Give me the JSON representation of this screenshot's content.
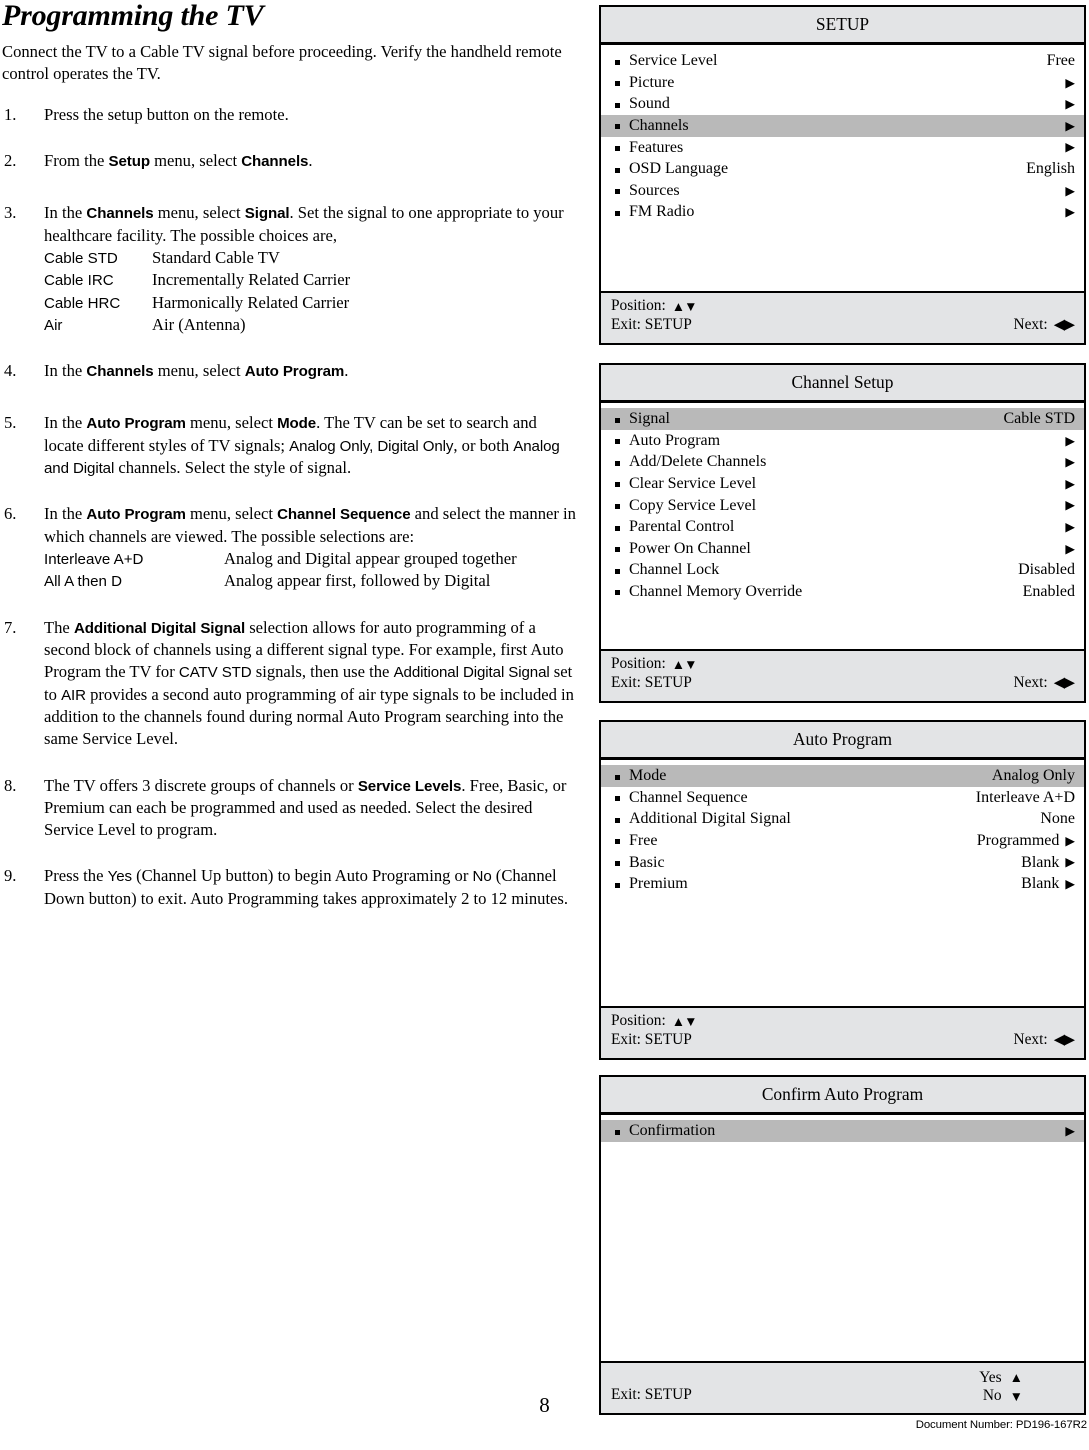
{
  "page": {
    "title": "Programming the TV",
    "intro": "Connect the TV to a Cable TV signal before proceeding.  Verify the handheld remote control operates the TV.",
    "page_number": "8",
    "document_number": "Document Number: PD196-167R2"
  },
  "steps": [
    {
      "num": "1.",
      "parts": [
        {
          "t": "Press the setup button on the remote.",
          "s": "serif"
        }
      ]
    },
    {
      "num": "2.",
      "parts": [
        {
          "t": "From the ",
          "s": "serif"
        },
        {
          "t": "Setup",
          "s": "sans-bold"
        },
        {
          "t": " menu, select ",
          "s": "serif"
        },
        {
          "t": "Channels",
          "s": "sans-bold"
        },
        {
          "t": ".",
          "s": "serif"
        }
      ]
    },
    {
      "num": "3.",
      "parts": [
        {
          "t": "In the ",
          "s": "serif"
        },
        {
          "t": "Channels",
          "s": "sans-bold"
        },
        {
          "t": " menu, select ",
          "s": "serif"
        },
        {
          "t": "Signal",
          "s": "sans-bold"
        },
        {
          "t": ".  Set the signal to one appropriate to your healthcare facility.  The possible choices are,",
          "s": "serif"
        }
      ],
      "deflist": [
        {
          "term": "Cable STD",
          "desc": "Standard Cable TV"
        },
        {
          "term": "Cable IRC",
          "desc": "Incrementally Related Carrier"
        },
        {
          "term": "Cable HRC",
          "desc": "Harmonically Related Carrier"
        },
        {
          "term": "Air",
          "desc": "Air (Antenna)"
        }
      ]
    },
    {
      "num": "4.",
      "parts": [
        {
          "t": "In the ",
          "s": "serif"
        },
        {
          "t": "Channels",
          "s": "sans-bold"
        },
        {
          "t": " menu, select ",
          "s": "serif"
        },
        {
          "t": "Auto Program",
          "s": "sans-bold"
        },
        {
          "t": ".",
          "s": "serif"
        }
      ]
    },
    {
      "num": "5.",
      "parts": [
        {
          "t": "In the ",
          "s": "serif"
        },
        {
          "t": "Auto Program",
          "s": "sans-bold"
        },
        {
          "t": " menu, select ",
          "s": "serif"
        },
        {
          "t": "Mode",
          "s": "sans-bold"
        },
        {
          "t": ".  The TV can be set to search and locate different styles of TV signals; ",
          "s": "serif"
        },
        {
          "t": "Analog Only, Digital Only",
          "s": "sans"
        },
        {
          "t": ", or both ",
          "s": "serif"
        },
        {
          "t": "Analog and Digital",
          "s": "sans"
        },
        {
          "t": " channels.  Select the style of signal.",
          "s": "serif"
        }
      ]
    },
    {
      "num": "6.",
      "parts": [
        {
          "t": "In the ",
          "s": "serif"
        },
        {
          "t": "Auto Program",
          "s": "sans-bold"
        },
        {
          "t": " menu, select ",
          "s": "serif"
        },
        {
          "t": "Channel Sequence",
          "s": "sans-bold"
        },
        {
          "t": " and select the manner in which channels are viewed.  The possible selections are:",
          "s": "serif"
        }
      ],
      "deflist": [
        {
          "term": "Interleave A+D",
          "desc": "Analog and Digital appear grouped together"
        },
        {
          "term": "All A then D",
          "desc": "Analog appear first, followed by Digital"
        }
      ]
    },
    {
      "num": "7.",
      "parts": [
        {
          "t": "The ",
          "s": "serif"
        },
        {
          "t": "Additional Digital Signal",
          "s": "sans-bold"
        },
        {
          "t": " selection allows for auto programming of a second block of channels using a different signal type.  For example, first Auto Program the TV for ",
          "s": "serif"
        },
        {
          "t": "CATV STD",
          "s": "sans"
        },
        {
          "t": " signals, then use the ",
          "s": "serif"
        },
        {
          "t": "Additional Digital Signal",
          "s": "sans"
        },
        {
          "t": " set to ",
          "s": "serif"
        },
        {
          "t": "AIR",
          "s": "sans"
        },
        {
          "t": " provides a second auto programming of air type signals to be included in addition to the channels found during normal Auto Program searching into the same Service Level.",
          "s": "serif"
        }
      ]
    },
    {
      "num": "8.",
      "parts": [
        {
          "t": "The TV offers 3 discrete groups of channels or ",
          "s": "serif"
        },
        {
          "t": "Service Levels",
          "s": "sans-bold"
        },
        {
          "t": ".  Free, Basic, or Premium can each be programmed and used as needed.  Select the desired Service Level to program.",
          "s": "serif"
        }
      ]
    },
    {
      "num": "9.",
      "parts": [
        {
          "t": "Press the ",
          "s": "serif"
        },
        {
          "t": "Yes",
          "s": "sans"
        },
        {
          "t": " (Channel Up button) to begin Auto Programing or ",
          "s": "serif"
        },
        {
          "t": "No",
          "s": "sans"
        },
        {
          "t": " (Channel Down button) to exit.   Auto Programming takes approximately 2 to 12 minutes.",
          "s": "serif"
        }
      ]
    }
  ],
  "osd_panels": [
    {
      "id": "setup",
      "title": "SETUP",
      "rows": [
        {
          "label": "Service Level",
          "value": "Free",
          "arrow": false,
          "selected": false
        },
        {
          "label": "Picture",
          "value": "",
          "arrow": true,
          "selected": false
        },
        {
          "label": "Sound",
          "value": "",
          "arrow": true,
          "selected": false
        },
        {
          "label": "Channels",
          "value": "",
          "arrow": true,
          "selected": true
        },
        {
          "label": "Features",
          "value": "",
          "arrow": true,
          "selected": false
        },
        {
          "label": "OSD Language",
          "value": "English",
          "arrow": false,
          "selected": false
        },
        {
          "label": "Sources",
          "value": "",
          "arrow": true,
          "selected": false
        },
        {
          "label": "FM Radio",
          "value": "",
          "arrow": true,
          "selected": false
        }
      ],
      "footer": {
        "type": "position",
        "position_label": "Position:",
        "position_glyphs": "▲▼",
        "exit_label": "Exit: SETUP",
        "next_label": "Next:",
        "next_glyphs": "◀▶"
      }
    },
    {
      "id": "channel-setup",
      "title": "Channel Setup",
      "rows": [
        {
          "label": "Signal",
          "value": "Cable STD",
          "arrow": false,
          "selected": true
        },
        {
          "label": "Auto Program",
          "value": "",
          "arrow": true,
          "selected": false
        },
        {
          "label": "Add/Delete Channels",
          "value": "",
          "arrow": true,
          "selected": false
        },
        {
          "label": "Clear Service Level",
          "value": "",
          "arrow": true,
          "selected": false
        },
        {
          "label": "Copy Service Level",
          "value": "",
          "arrow": true,
          "selected": false
        },
        {
          "label": "Parental Control",
          "value": "",
          "arrow": true,
          "selected": false
        },
        {
          "label": "Power On Channel",
          "value": "",
          "arrow": true,
          "selected": false
        },
        {
          "label": "Channel Lock",
          "value": "Disabled",
          "arrow": false,
          "selected": false
        },
        {
          "label": "Channel Memory Override",
          "value": "Enabled",
          "arrow": false,
          "selected": false
        }
      ],
      "footer": {
        "type": "position",
        "position_label": "Position:",
        "position_glyphs": "▲▼",
        "exit_label": "Exit: SETUP",
        "next_label": "Next:",
        "next_glyphs": "◀▶"
      }
    },
    {
      "id": "auto-program",
      "title": "Auto Program",
      "rows": [
        {
          "label": "Mode",
          "value": "Analog Only",
          "arrow": false,
          "selected": true
        },
        {
          "label": "Channel Sequence",
          "value": "Interleave A+D",
          "arrow": false,
          "selected": false
        },
        {
          "label": "Additional Digital Signal",
          "value": "None",
          "arrow": false,
          "selected": false
        },
        {
          "label": "Free",
          "value": "Programmed",
          "arrow": true,
          "selected": false
        },
        {
          "label": "Basic",
          "value": "Blank",
          "arrow": true,
          "selected": false
        },
        {
          "label": "Premium",
          "value": "Blank",
          "arrow": true,
          "selected": false
        }
      ],
      "footer": {
        "type": "position",
        "position_label": "Position:",
        "position_glyphs": "▲▼",
        "exit_label": "Exit: SETUP",
        "next_label": "Next:",
        "next_glyphs": "◀▶"
      }
    },
    {
      "id": "confirm-auto-program",
      "title": "Confirm Auto Program",
      "rows": [
        {
          "label": "Confirmation",
          "value": "",
          "arrow": true,
          "selected": true
        }
      ],
      "footer": {
        "type": "yesno",
        "exit_label": "Exit: SETUP",
        "yes_label": "Yes",
        "yes_glyph": "▲",
        "no_label": "No",
        "no_glyph": "▼"
      }
    }
  ]
}
